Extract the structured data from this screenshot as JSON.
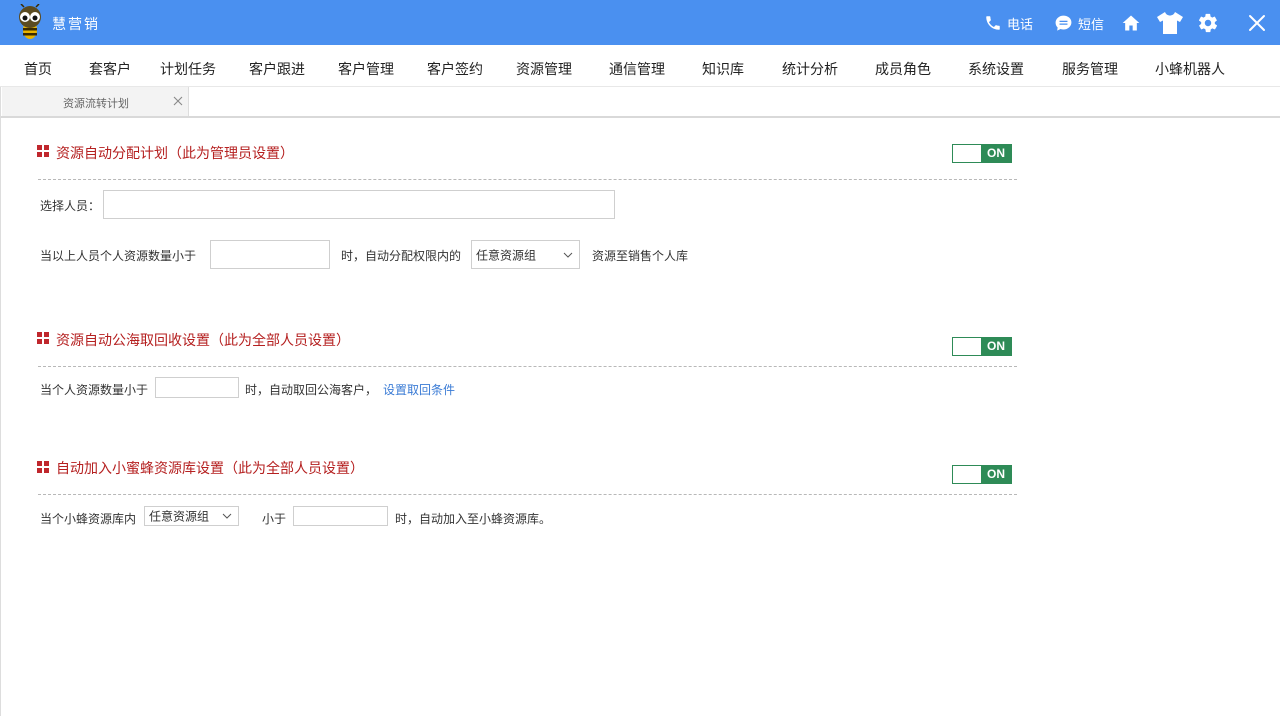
{
  "app": {
    "title": "慧营销"
  },
  "toolbar": {
    "phone_label": "电话",
    "sms_label": "短信",
    "icons": [
      "phone-icon",
      "sms-icon",
      "home-icon",
      "shirt-icon",
      "gear-icon",
      "close-icon"
    ]
  },
  "nav": {
    "items": [
      "首页",
      "套客户",
      "计划任务",
      "客户跟进",
      "客户管理",
      "客户签约",
      "资源管理",
      "通信管理",
      "知识库",
      "统计分析",
      "成员角色",
      "系统设置",
      "服务管理",
      "小蜂机器人"
    ]
  },
  "tabs": [
    {
      "label": "资源流转计划"
    }
  ],
  "sections": {
    "auto_assign": {
      "title": "资源自动分配计划（此为管理员设置）",
      "toggle": "ON",
      "select_staff_label": "选择人员：",
      "select_staff_value": "",
      "rule_prefix": "当以上人员个人资源数量小于",
      "threshold_value": "",
      "rule_mid": "时，自动分配权限内的",
      "group_select": "任意资源组",
      "rule_suffix": "资源至销售个人库"
    },
    "public_pool": {
      "title": "资源自动公海取回收设置（此为全部人员设置）",
      "toggle": "ON",
      "rule_prefix": "当个人资源数量小于",
      "threshold_value": "",
      "rule_mid": "时，自动取回公海客户，",
      "link_label": "设置取回条件"
    },
    "bee_pool": {
      "title": "自动加入小蜜蜂资源库设置（此为全部人员设置）",
      "toggle": "ON",
      "rule_prefix": "当个小蜂资源库内",
      "group_select": "任意资源组",
      "less_than": "小于",
      "threshold_value": "",
      "rule_suffix": "时，自动加入至小蜂资源库。"
    }
  },
  "colors": {
    "titlebar": "#4a90f0",
    "section_title": "#b52020",
    "toggle_on": "#2e8b57",
    "link": "#3a7bd5"
  }
}
